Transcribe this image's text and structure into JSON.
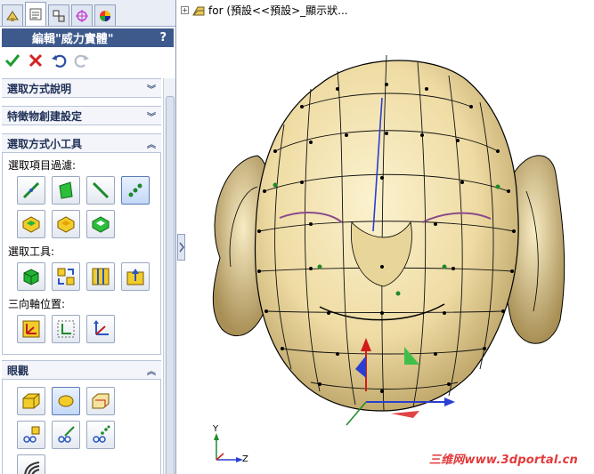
{
  "property_manager": {
    "tabs": [
      {
        "name": "feature-manager-tab",
        "icon": "feature-tree-icon"
      },
      {
        "name": "property-manager-tab",
        "icon": "property-sheet-icon"
      },
      {
        "name": "configuration-manager-tab",
        "icon": "configuration-icon"
      },
      {
        "name": "dimxpert-tab",
        "icon": "crosshair-icon"
      },
      {
        "name": "display-manager-tab",
        "icon": "color-wheel-icon"
      }
    ],
    "title": "編輯\"威力實體\"",
    "help": "?",
    "groups": {
      "selection_desc": "選取方式說明",
      "feature_create": "特徵物創建設定",
      "selection_tools": "選取方式小工具",
      "display": "眼觀"
    },
    "filter_label": "選取項目過濾:",
    "tools_label": "選取工具:",
    "triad_label": "三向軸位置:",
    "colors": {
      "title_bar": "#3e5a8c",
      "ok": "#1e9c2e",
      "cancel": "#d22323"
    }
  },
  "viewport": {
    "tree_item": "for (預設<<預設>_顯示狀...",
    "triad": {
      "y": "Y",
      "z": "Z"
    },
    "watermark_cn": "三维网",
    "watermark_url": "www.3dportal.cn"
  }
}
